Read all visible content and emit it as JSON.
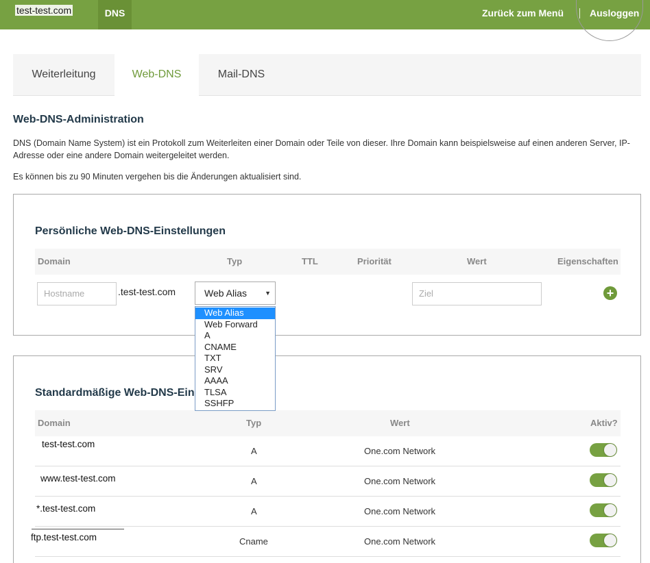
{
  "header": {
    "site_name": "test-test.com",
    "nav_active": "DNS",
    "back_label": "Zurück zum Menü",
    "logout_label": "Ausloggen",
    "brand_color": "#77a142"
  },
  "tabs": [
    {
      "label": "Weiterleitung",
      "active": false
    },
    {
      "label": "Web-DNS",
      "active": true
    },
    {
      "label": "Mail-DNS",
      "active": false
    }
  ],
  "intro": {
    "title": "Web-DNS-Administration",
    "description": "DNS (Domain Name System) ist ein Protokoll zum Weiterleiten einer Domain oder Teile von dieser. Ihre Domain kann beispielsweise auf einen anderen Server, IP-Adresse oder eine andere Domain weitergeleitet werden.",
    "note": "Es können bis zu 90 Minuten vergehen bis die Änderungen aktualisiert sind."
  },
  "personal": {
    "title": "Persönliche Web-DNS-Einstellungen",
    "columns": [
      "Domain",
      "Typ",
      "TTL",
      "Priorität",
      "Wert",
      "Eigenschaften"
    ],
    "hostname_placeholder": "Hostname",
    "domain_suffix": ".test-test.com",
    "type_selected": "Web Alias",
    "value_placeholder": "Ziel",
    "add_icon": "plus-circle-icon",
    "type_options": [
      "Web Alias",
      "Web Forward",
      "A",
      "CNAME",
      "TXT",
      "SRV",
      "AAAA",
      "TLSA",
      "SSHFP"
    ]
  },
  "standard": {
    "title": "Standardmäßige Web-DNS-Eins",
    "columns": [
      "Domain",
      "Typ",
      "Wert",
      "Aktiv?"
    ],
    "rows": [
      {
        "domain": "test-test.com",
        "type": "A",
        "value": "One.com Network",
        "active": true
      },
      {
        "domain": "www.test-test.com",
        "type": "A",
        "value": "One.com Network",
        "active": true
      },
      {
        "domain": "*.test-test.com",
        "type": "A",
        "value": "One.com Network",
        "active": true
      },
      {
        "domain": "ftp.test-test.com",
        "type": "Cname",
        "value": "One.com Network",
        "active": true
      }
    ]
  }
}
